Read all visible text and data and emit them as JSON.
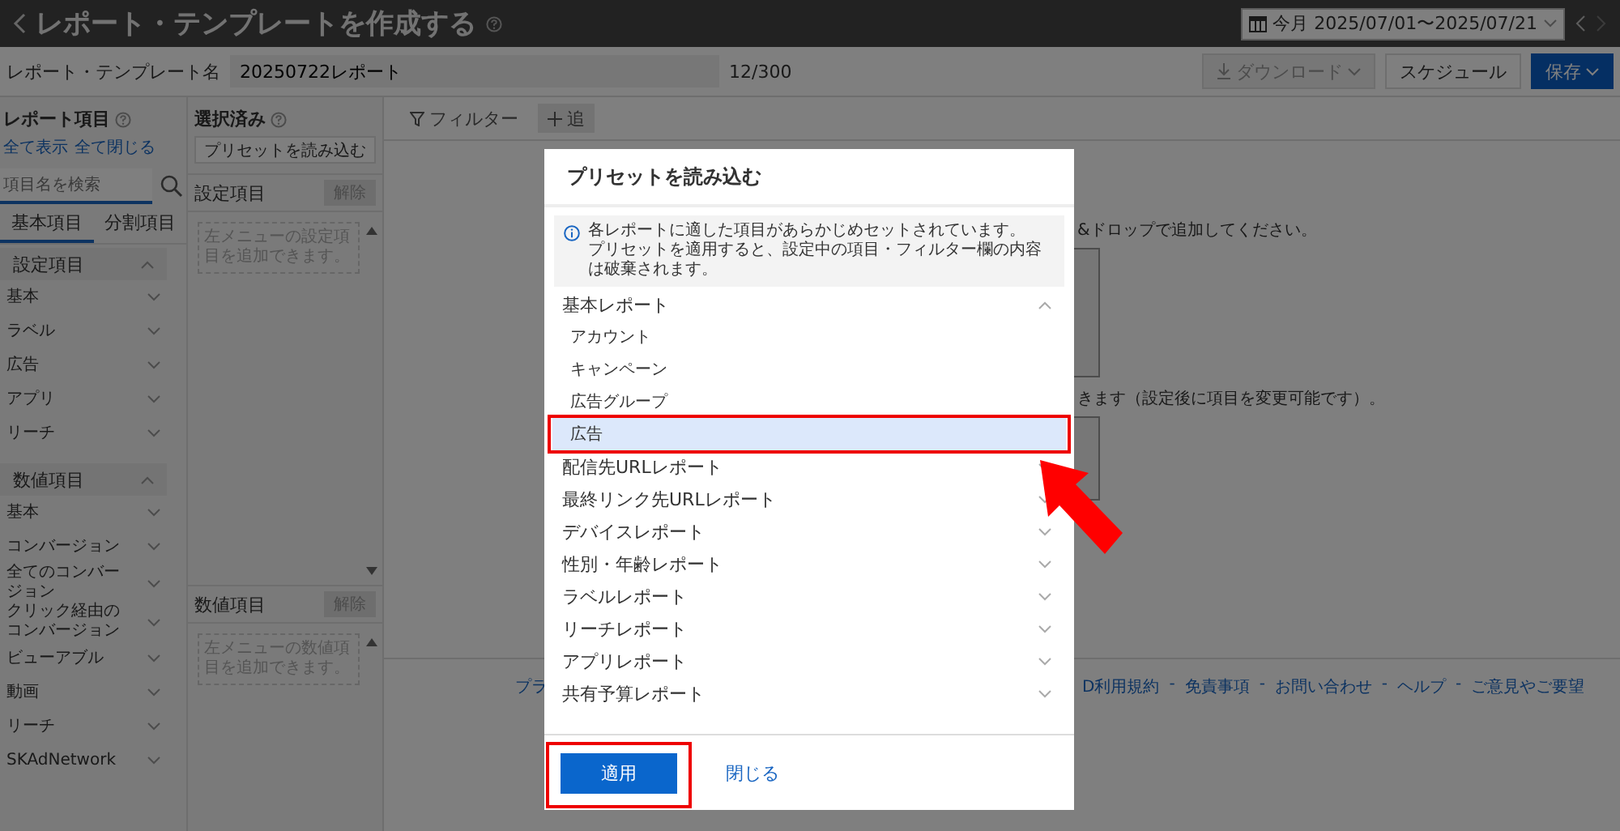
{
  "header": {
    "title": "レポート・テンプレートを作成する",
    "date_range": "今月 2025/07/01〜2025/07/21"
  },
  "template_name": {
    "label": "レポート・テンプレート名",
    "value": "20250722レポート",
    "counter": "12/300"
  },
  "actions": {
    "download": "ダウンロード",
    "download_disabled": true,
    "schedule": "スケジュール",
    "save": "保存"
  },
  "sidebar": {
    "title": "レポート項目",
    "show_all": "全て表示",
    "collapse_all": "全て閉じる",
    "search_placeholder": "項目名を検索",
    "tabs": [
      {
        "label": "基本項目",
        "selected": true
      },
      {
        "label": "分割項目",
        "selected": false
      }
    ],
    "sections": [
      {
        "label": "設定項目",
        "expanded": true,
        "items": [
          {
            "label": "基本",
            "expanded": false
          },
          {
            "label": "ラベル",
            "expanded": false
          },
          {
            "label": "広告",
            "expanded": false
          },
          {
            "label": "アプリ",
            "expanded": false
          },
          {
            "label": "リーチ",
            "expanded": false
          }
        ]
      },
      {
        "label": "数値項目",
        "expanded": true,
        "items": [
          {
            "label": "基本",
            "expanded": false
          },
          {
            "label": "コンバージョン",
            "expanded": false
          },
          {
            "label": "全てのコンバージョン",
            "expanded": false
          },
          {
            "label": "クリック経由のコンバージョン",
            "expanded": false
          },
          {
            "label": "ビューアブル",
            "expanded": false
          },
          {
            "label": "動画",
            "expanded": false
          },
          {
            "label": "リーチ",
            "expanded": false
          },
          {
            "label": "SKAdNetwork",
            "expanded": false
          }
        ]
      }
    ]
  },
  "selected_panel": {
    "title": "選択済み",
    "preset_button": "プリセットを読み込む",
    "groups": [
      {
        "label": "設定項目",
        "clear": "解除",
        "placeholder": "左メニューの設定項目を追加できます。"
      },
      {
        "label": "数値項目",
        "clear": "解除",
        "placeholder": "左メニューの数値項目を追加できます。"
      }
    ]
  },
  "main": {
    "filter": "フィルター",
    "add": "追",
    "hints": [
      "&ドロップで追加してください。",
      "きます（設定後に項目を変更可能です）。"
    ],
    "footer_cut": "プラ",
    "footer_links": [
      "D利用規約",
      "免責事項",
      "お問い合わせ",
      "ヘルプ",
      "ご意見やご要望"
    ],
    "separator": "-"
  },
  "modal": {
    "title": "プリセットを読み込む",
    "info": [
      "各レポートに適した項目があらかじめセットされています。",
      "プリセットを適用すると、設定中の項目・フィルター欄の内容は破棄されます。"
    ],
    "groups": [
      {
        "label": "基本レポート",
        "expanded": true,
        "children": [
          {
            "label": "アカウント",
            "selected": false
          },
          {
            "label": "キャンペーン",
            "selected": false
          },
          {
            "label": "広告グループ",
            "selected": false
          },
          {
            "label": "広告",
            "selected": true
          }
        ]
      },
      {
        "label": "配信先URLレポート",
        "expanded": false
      },
      {
        "label": "最終リンク先URLレポート",
        "expanded": false
      },
      {
        "label": "デバイスレポート",
        "expanded": false
      },
      {
        "label": "性別・年齢レポート",
        "expanded": false
      },
      {
        "label": "ラベルレポート",
        "expanded": false
      },
      {
        "label": "リーチレポート",
        "expanded": false
      },
      {
        "label": "アプリレポート",
        "expanded": false
      },
      {
        "label": "共有予算レポート",
        "expanded": false
      }
    ],
    "apply": "適用",
    "close": "閉じる"
  }
}
